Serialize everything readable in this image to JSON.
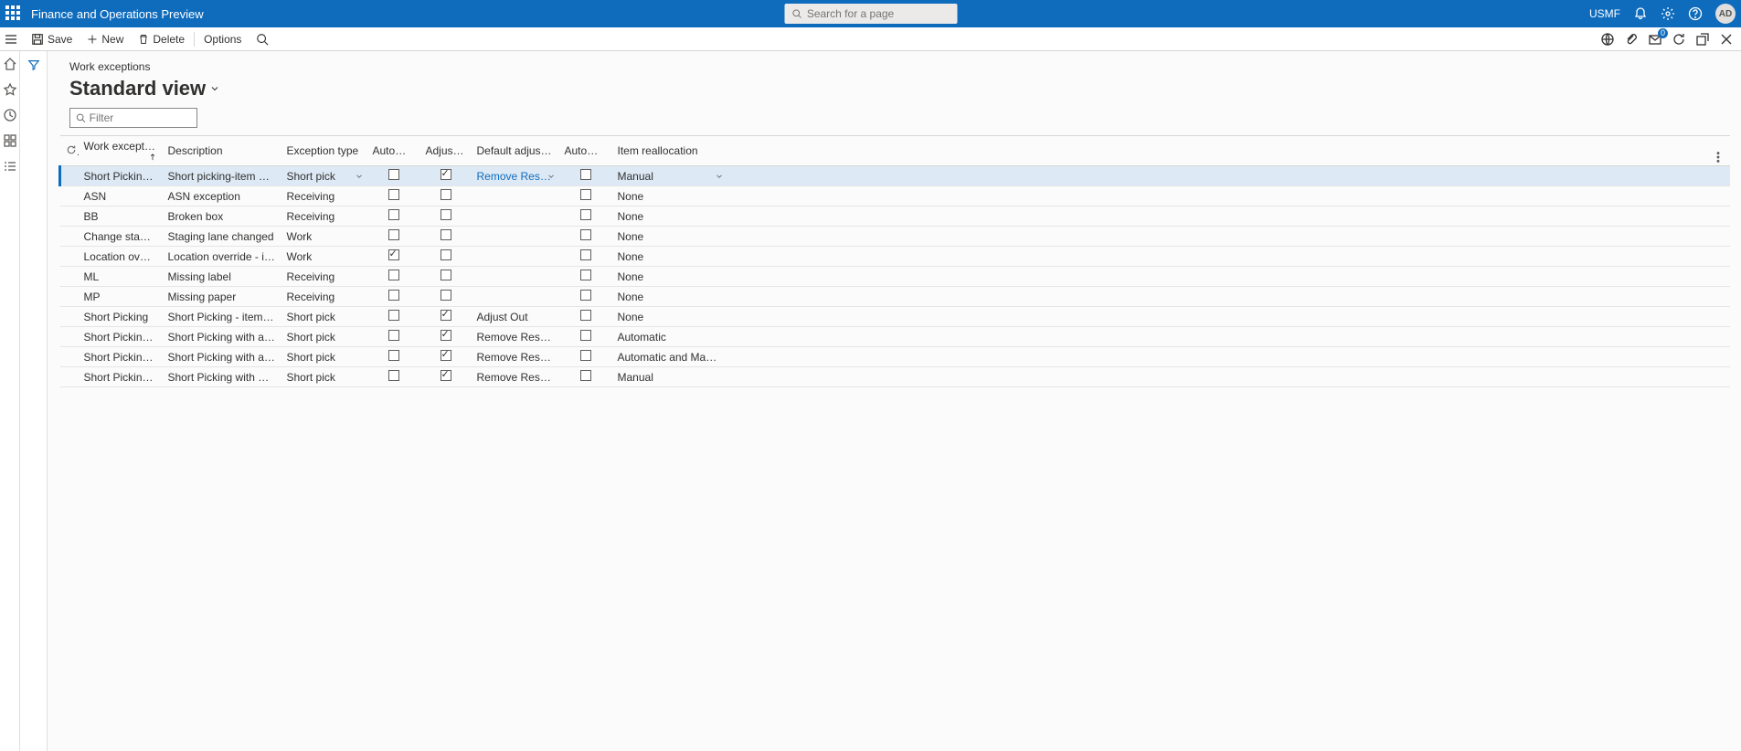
{
  "brand": {
    "title": "Finance and Operations Preview",
    "company": "USMF",
    "avatar": "AD"
  },
  "search": {
    "placeholder": "Search for a page"
  },
  "actions": {
    "save": "Save",
    "new": "New",
    "delete": "Delete",
    "options": "Options"
  },
  "page": {
    "breadcrumb": "Work exceptions",
    "view": "Standard view",
    "filter_placeholder": "Filter"
  },
  "columns": {
    "code": "Work exceptio...",
    "desc": "Description",
    "type": "Exception type",
    "auto1": "Automatic...",
    "adj": "Adjust inv...",
    "defadj": "Default adjustment...",
    "auto2": "Automatic...",
    "realloc": "Item reallocation"
  },
  "rows": [
    {
      "code": "Short Picking Ma...",
      "desc": "Short picking-item not av...",
      "type": "Short pick",
      "auto1": false,
      "adj": true,
      "defadj": "Remove Res A...",
      "auto2": false,
      "realloc": "Manual",
      "sel": true,
      "drop": true
    },
    {
      "code": "ASN",
      "desc": "ASN exception",
      "type": "Receiving",
      "auto1": false,
      "adj": false,
      "defadj": "",
      "auto2": false,
      "realloc": "None"
    },
    {
      "code": "BB",
      "desc": "Broken box",
      "type": "Receiving",
      "auto1": false,
      "adj": false,
      "defadj": "",
      "auto2": false,
      "realloc": "None"
    },
    {
      "code": "Change staging",
      "desc": "Staging lane changed",
      "type": "Work",
      "auto1": false,
      "adj": false,
      "defadj": "",
      "auto2": false,
      "realloc": "None"
    },
    {
      "code": "Location override",
      "desc": "Location override - item n...",
      "type": "Work",
      "auto1": true,
      "adj": false,
      "defadj": "",
      "auto2": false,
      "realloc": "None"
    },
    {
      "code": "ML",
      "desc": "Missing label",
      "type": "Receiving",
      "auto1": false,
      "adj": false,
      "defadj": "",
      "auto2": false,
      "realloc": "None"
    },
    {
      "code": "MP",
      "desc": "Missing paper",
      "type": "Receiving",
      "auto1": false,
      "adj": false,
      "defadj": "",
      "auto2": false,
      "realloc": "None"
    },
    {
      "code": "Short Picking",
      "desc": "Short Picking - item not t...",
      "type": "Short pick",
      "auto1": false,
      "adj": true,
      "defadj": "Adjust Out",
      "auto2": false,
      "realloc": "None"
    },
    {
      "code": "Short Picking Auto",
      "desc": "Short Picking with autom...",
      "type": "Short pick",
      "auto1": false,
      "adj": true,
      "defadj": "Remove Res Adj ...",
      "auto2": false,
      "realloc": "Automatic"
    },
    {
      "code": "Short Picking Aut...",
      "desc": "Short Picking with autom...",
      "type": "Short pick",
      "auto1": false,
      "adj": true,
      "defadj": "Remove Res Adj ...",
      "auto2": false,
      "realloc": "Automatic and Manual"
    },
    {
      "code": "Short Picking Ma...",
      "desc": "Short Picking with manua...",
      "type": "Short pick",
      "auto1": false,
      "adj": true,
      "defadj": "Remove Res Adj ...",
      "auto2": false,
      "realloc": "Manual"
    }
  ],
  "notifications": "0"
}
